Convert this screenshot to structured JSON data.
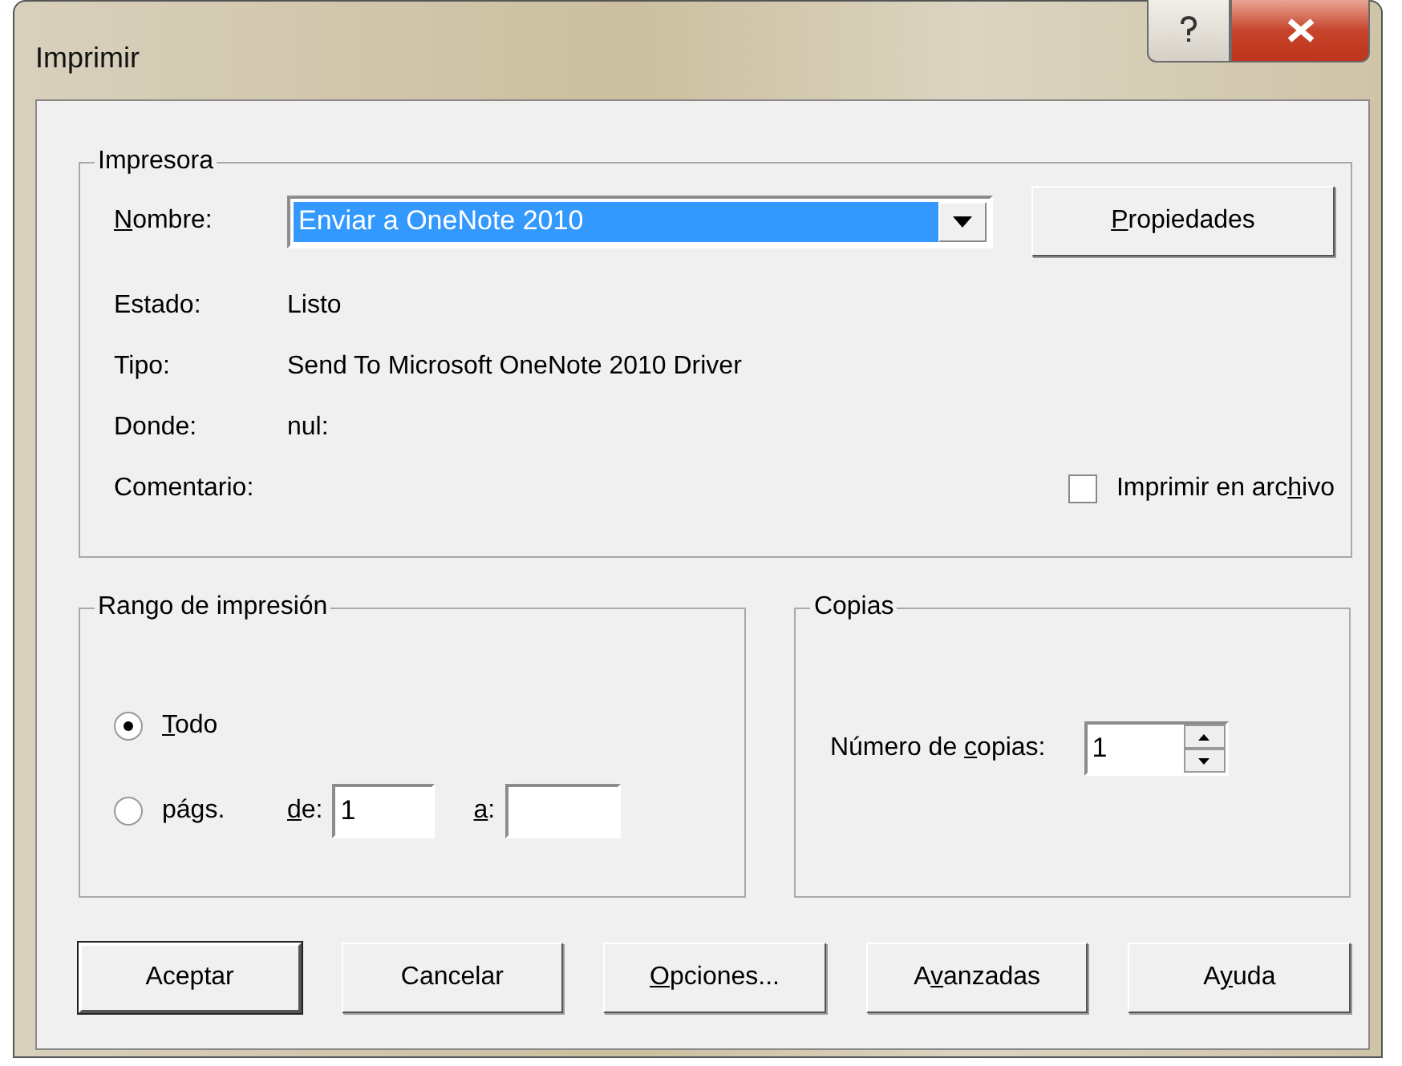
{
  "window": {
    "title": "Imprimir"
  },
  "printer": {
    "title": "Impresora",
    "name_label": [
      {
        "text": "N",
        "u": true
      },
      {
        "text": "ombre:"
      }
    ],
    "name_value": "Enviar a OneNote 2010",
    "name_highlighted": true,
    "properties_button": [
      {
        "text": "P",
        "u": true
      },
      {
        "text": "ropiedades"
      }
    ],
    "info": [
      {
        "label": "Estado:",
        "value": "Listo"
      },
      {
        "label": "Tipo:",
        "value": "Send To Microsoft OneNote 2010 Driver"
      },
      {
        "label": "Donde:",
        "value": "nul:"
      },
      {
        "label": "Comentario:"
      }
    ],
    "print_to_file": {
      "label": [
        {
          "text": "Imprimir en arc"
        },
        {
          "text": "h",
          "u": true
        },
        {
          "text": "ivo"
        }
      ],
      "checked": false
    }
  },
  "range": {
    "title": "Rango de impresión",
    "options": [
      {
        "label": [
          {
            "text": "T",
            "u": true
          },
          {
            "text": "odo"
          }
        ],
        "selected": true
      },
      {
        "label": [
          {
            "text": "págs."
          }
        ],
        "selected": false
      }
    ],
    "from": {
      "label": [
        {
          "text": "d",
          "u": true
        },
        {
          "text": "e:"
        }
      ],
      "value": "1"
    },
    "to": {
      "label": [
        {
          "text": "a",
          "u": true
        },
        {
          "text": ":"
        }
      ]
    }
  },
  "copies": {
    "title": "Copias",
    "label": [
      {
        "text": "Número de "
      },
      {
        "text": "c",
        "u": true
      },
      {
        "text": "opias:"
      }
    ],
    "value": "1"
  },
  "buttons": [
    {
      "label": [
        {
          "text": "Aceptar"
        }
      ],
      "default": true
    },
    {
      "label": [
        {
          "text": "Cancelar"
        }
      ],
      "default": false
    },
    {
      "label": [
        {
          "text": "O",
          "u": true
        },
        {
          "text": "pciones..."
        }
      ],
      "default": false
    },
    {
      "label": [
        {
          "text": "A"
        },
        {
          "text": "v",
          "u": true
        },
        {
          "text": "anzadas"
        }
      ],
      "default": false
    },
    {
      "label": [
        {
          "text": "A"
        },
        {
          "text": "y",
          "u": true
        },
        {
          "text": "uda"
        }
      ],
      "default": false
    }
  ]
}
